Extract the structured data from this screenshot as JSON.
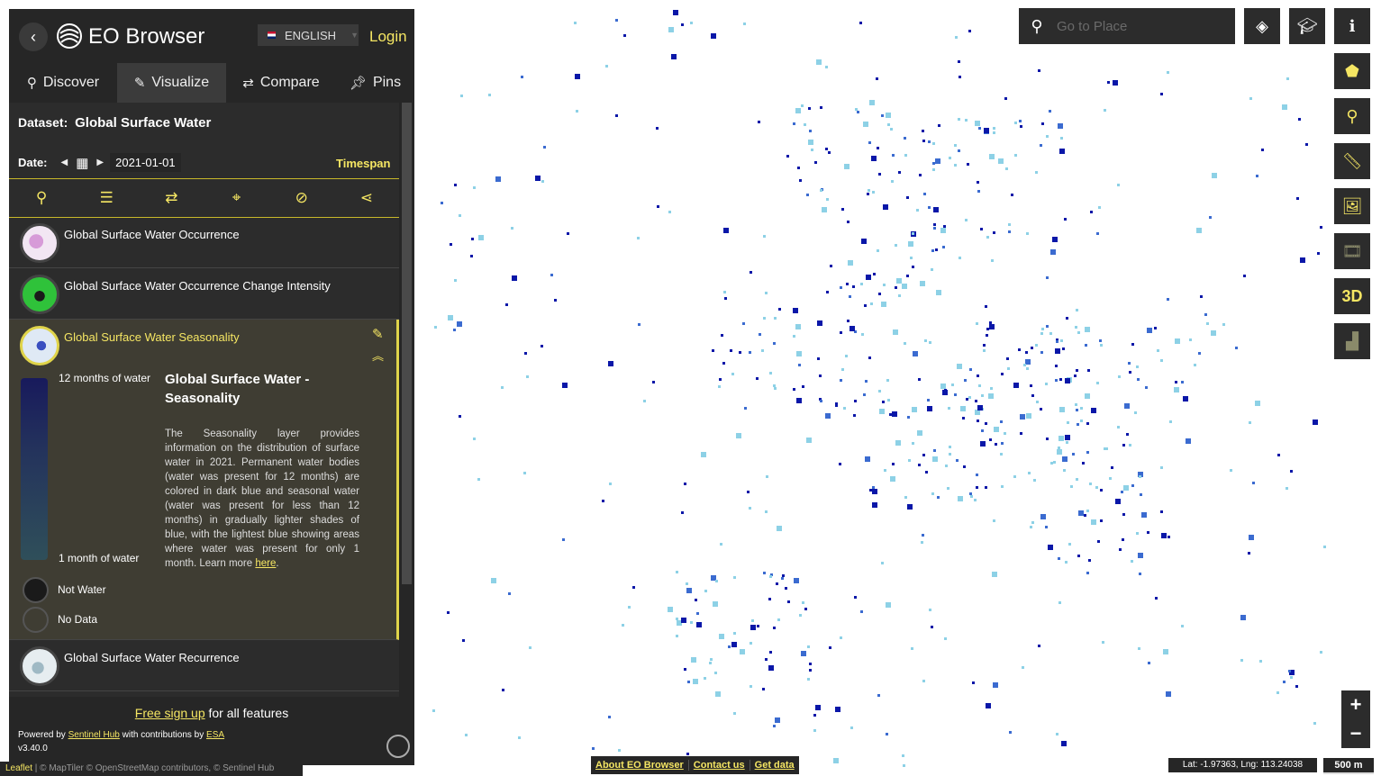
{
  "app": {
    "title": "EO Browser",
    "language": "ENGLISH",
    "login": "Login"
  },
  "tabs": [
    {
      "label": "Discover",
      "icon": "search-icon"
    },
    {
      "label": "Visualize",
      "icon": "brush-icon"
    },
    {
      "label": "Compare",
      "icon": "swap-icon"
    },
    {
      "label": "Pins",
      "icon": "pin-icon"
    }
  ],
  "dataset": {
    "label": "Dataset:",
    "value": "Global Surface Water"
  },
  "date": {
    "label": "Date:",
    "value": "2021-01-01",
    "timespan": "Timespan"
  },
  "toolbar": [
    "pin-icon",
    "sliders-icon",
    "compare-icon",
    "crosshair-icon",
    "hide-icon",
    "share-icon"
  ],
  "layers": [
    {
      "title": "Global Surface Water Occurrence"
    },
    {
      "title": "Global Surface Water Occurrence Change Intensity"
    },
    {
      "title": "Global Surface Water Seasonality"
    },
    {
      "title": "Global Surface Water Recurrence"
    }
  ],
  "legend": {
    "top": "12 months of water",
    "bottom": "1 month of water",
    "not_water": "Not Water",
    "no_data": "No Data",
    "gradient_colors": [
      "#181a5c",
      "#2f4f5a"
    ],
    "not_water_color": "#1a1a1a",
    "no_data_color": "#3f3d33"
  },
  "description": {
    "title": "Global Surface Water - Seasonality",
    "text": "The Seasonality layer provides information on the distribution of surface water in 2021. Permanent water bodies (water was present for 12 months) are colored in dark blue and seasonal water (water was present for less than 12 months) in gradually lighter shades of blue, with the lightest blue showing areas where water was present for only 1 month. Learn more",
    "link": "here",
    "end": "."
  },
  "footer": {
    "signup_link": "Free sign up",
    "signup_rest": " for all features",
    "powered_by": "Powered by ",
    "sentinel_hub": "Sentinel Hub",
    "contributions": " with contributions by ",
    "esa": "ESA",
    "version": "v3.40.0"
  },
  "attribution": {
    "leaflet": "Leaflet",
    "rest": " | © MapTiler © OpenStreetMap contributors, © Sentinel Hub"
  },
  "search": {
    "placeholder": "Go to Place"
  },
  "map_buttons": {
    "top": [
      "layers-icon",
      "education-icon",
      "info-icon"
    ],
    "side": [
      "polygon-icon",
      "location-pin-icon",
      "ruler-icon",
      "image-download-icon",
      "film-icon",
      "3D",
      "chart-icon"
    ]
  },
  "bottom_links": [
    "About EO Browser",
    "Contact us",
    "Get data"
  ],
  "coords": "Lat: -1.97363, Lng: 113.24038",
  "scale": "500 m",
  "colors": {
    "accent": "#f5e663",
    "panel": "#2c2c2c",
    "dark_water": "#0a17a8",
    "light_water": "#8dd1e6"
  }
}
